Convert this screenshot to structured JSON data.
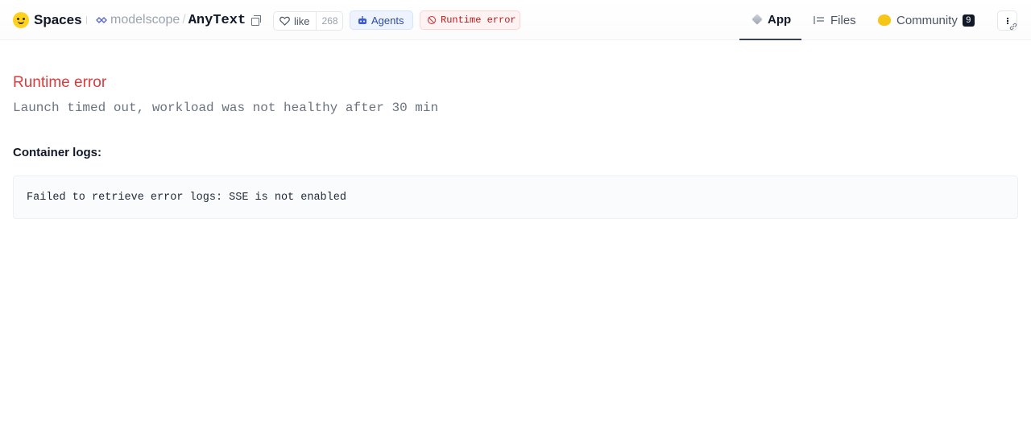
{
  "header": {
    "brand": "Spaces",
    "org": "modelscope",
    "separator": "/",
    "repo": "AnyText",
    "like": {
      "label": "like",
      "count": "268"
    },
    "agents_badge": "Agents",
    "status_badge": "Runtime error",
    "tabs": [
      {
        "label": "App",
        "icon": "cube-icon",
        "active": true
      },
      {
        "label": "Files",
        "icon": "files-icon",
        "active": false
      },
      {
        "label": "Community",
        "icon": "community-icon",
        "active": false,
        "badge": "9"
      }
    ]
  },
  "main": {
    "error_title": "Runtime error",
    "error_message": "Launch timed out, workload was not healthy after 30 min",
    "logs_heading": "Container logs:",
    "logs_text": "Failed to retrieve error logs: SSE is not enabled"
  },
  "colors": {
    "error_red": "#dc3b3b",
    "agents_blue": "#2d4ba8",
    "badge_black": "#111827"
  }
}
